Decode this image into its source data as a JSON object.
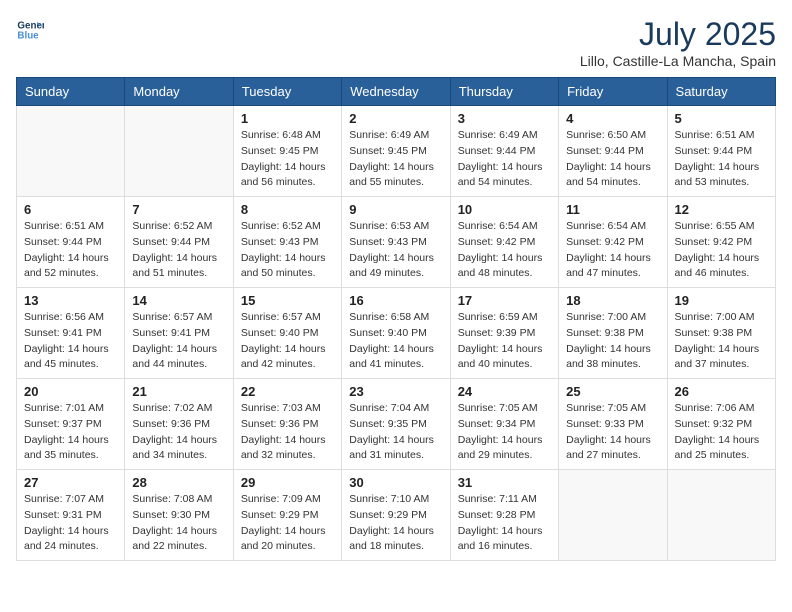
{
  "header": {
    "logo_line1": "General",
    "logo_line2": "Blue",
    "month_year": "July 2025",
    "location": "Lillo, Castille-La Mancha, Spain"
  },
  "weekdays": [
    "Sunday",
    "Monday",
    "Tuesday",
    "Wednesday",
    "Thursday",
    "Friday",
    "Saturday"
  ],
  "weeks": [
    [
      {
        "day": "",
        "sunrise": "",
        "sunset": "",
        "daylight": ""
      },
      {
        "day": "",
        "sunrise": "",
        "sunset": "",
        "daylight": ""
      },
      {
        "day": "1",
        "sunrise": "Sunrise: 6:48 AM",
        "sunset": "Sunset: 9:45 PM",
        "daylight": "Daylight: 14 hours and 56 minutes."
      },
      {
        "day": "2",
        "sunrise": "Sunrise: 6:49 AM",
        "sunset": "Sunset: 9:45 PM",
        "daylight": "Daylight: 14 hours and 55 minutes."
      },
      {
        "day": "3",
        "sunrise": "Sunrise: 6:49 AM",
        "sunset": "Sunset: 9:44 PM",
        "daylight": "Daylight: 14 hours and 54 minutes."
      },
      {
        "day": "4",
        "sunrise": "Sunrise: 6:50 AM",
        "sunset": "Sunset: 9:44 PM",
        "daylight": "Daylight: 14 hours and 54 minutes."
      },
      {
        "day": "5",
        "sunrise": "Sunrise: 6:51 AM",
        "sunset": "Sunset: 9:44 PM",
        "daylight": "Daylight: 14 hours and 53 minutes."
      }
    ],
    [
      {
        "day": "6",
        "sunrise": "Sunrise: 6:51 AM",
        "sunset": "Sunset: 9:44 PM",
        "daylight": "Daylight: 14 hours and 52 minutes."
      },
      {
        "day": "7",
        "sunrise": "Sunrise: 6:52 AM",
        "sunset": "Sunset: 9:44 PM",
        "daylight": "Daylight: 14 hours and 51 minutes."
      },
      {
        "day": "8",
        "sunrise": "Sunrise: 6:52 AM",
        "sunset": "Sunset: 9:43 PM",
        "daylight": "Daylight: 14 hours and 50 minutes."
      },
      {
        "day": "9",
        "sunrise": "Sunrise: 6:53 AM",
        "sunset": "Sunset: 9:43 PM",
        "daylight": "Daylight: 14 hours and 49 minutes."
      },
      {
        "day": "10",
        "sunrise": "Sunrise: 6:54 AM",
        "sunset": "Sunset: 9:42 PM",
        "daylight": "Daylight: 14 hours and 48 minutes."
      },
      {
        "day": "11",
        "sunrise": "Sunrise: 6:54 AM",
        "sunset": "Sunset: 9:42 PM",
        "daylight": "Daylight: 14 hours and 47 minutes."
      },
      {
        "day": "12",
        "sunrise": "Sunrise: 6:55 AM",
        "sunset": "Sunset: 9:42 PM",
        "daylight": "Daylight: 14 hours and 46 minutes."
      }
    ],
    [
      {
        "day": "13",
        "sunrise": "Sunrise: 6:56 AM",
        "sunset": "Sunset: 9:41 PM",
        "daylight": "Daylight: 14 hours and 45 minutes."
      },
      {
        "day": "14",
        "sunrise": "Sunrise: 6:57 AM",
        "sunset": "Sunset: 9:41 PM",
        "daylight": "Daylight: 14 hours and 44 minutes."
      },
      {
        "day": "15",
        "sunrise": "Sunrise: 6:57 AM",
        "sunset": "Sunset: 9:40 PM",
        "daylight": "Daylight: 14 hours and 42 minutes."
      },
      {
        "day": "16",
        "sunrise": "Sunrise: 6:58 AM",
        "sunset": "Sunset: 9:40 PM",
        "daylight": "Daylight: 14 hours and 41 minutes."
      },
      {
        "day": "17",
        "sunrise": "Sunrise: 6:59 AM",
        "sunset": "Sunset: 9:39 PM",
        "daylight": "Daylight: 14 hours and 40 minutes."
      },
      {
        "day": "18",
        "sunrise": "Sunrise: 7:00 AM",
        "sunset": "Sunset: 9:38 PM",
        "daylight": "Daylight: 14 hours and 38 minutes."
      },
      {
        "day": "19",
        "sunrise": "Sunrise: 7:00 AM",
        "sunset": "Sunset: 9:38 PM",
        "daylight": "Daylight: 14 hours and 37 minutes."
      }
    ],
    [
      {
        "day": "20",
        "sunrise": "Sunrise: 7:01 AM",
        "sunset": "Sunset: 9:37 PM",
        "daylight": "Daylight: 14 hours and 35 minutes."
      },
      {
        "day": "21",
        "sunrise": "Sunrise: 7:02 AM",
        "sunset": "Sunset: 9:36 PM",
        "daylight": "Daylight: 14 hours and 34 minutes."
      },
      {
        "day": "22",
        "sunrise": "Sunrise: 7:03 AM",
        "sunset": "Sunset: 9:36 PM",
        "daylight": "Daylight: 14 hours and 32 minutes."
      },
      {
        "day": "23",
        "sunrise": "Sunrise: 7:04 AM",
        "sunset": "Sunset: 9:35 PM",
        "daylight": "Daylight: 14 hours and 31 minutes."
      },
      {
        "day": "24",
        "sunrise": "Sunrise: 7:05 AM",
        "sunset": "Sunset: 9:34 PM",
        "daylight": "Daylight: 14 hours and 29 minutes."
      },
      {
        "day": "25",
        "sunrise": "Sunrise: 7:05 AM",
        "sunset": "Sunset: 9:33 PM",
        "daylight": "Daylight: 14 hours and 27 minutes."
      },
      {
        "day": "26",
        "sunrise": "Sunrise: 7:06 AM",
        "sunset": "Sunset: 9:32 PM",
        "daylight": "Daylight: 14 hours and 25 minutes."
      }
    ],
    [
      {
        "day": "27",
        "sunrise": "Sunrise: 7:07 AM",
        "sunset": "Sunset: 9:31 PM",
        "daylight": "Daylight: 14 hours and 24 minutes."
      },
      {
        "day": "28",
        "sunrise": "Sunrise: 7:08 AM",
        "sunset": "Sunset: 9:30 PM",
        "daylight": "Daylight: 14 hours and 22 minutes."
      },
      {
        "day": "29",
        "sunrise": "Sunrise: 7:09 AM",
        "sunset": "Sunset: 9:29 PM",
        "daylight": "Daylight: 14 hours and 20 minutes."
      },
      {
        "day": "30",
        "sunrise": "Sunrise: 7:10 AM",
        "sunset": "Sunset: 9:29 PM",
        "daylight": "Daylight: 14 hours and 18 minutes."
      },
      {
        "day": "31",
        "sunrise": "Sunrise: 7:11 AM",
        "sunset": "Sunset: 9:28 PM",
        "daylight": "Daylight: 14 hours and 16 minutes."
      },
      {
        "day": "",
        "sunrise": "",
        "sunset": "",
        "daylight": ""
      },
      {
        "day": "",
        "sunrise": "",
        "sunset": "",
        "daylight": ""
      }
    ]
  ]
}
